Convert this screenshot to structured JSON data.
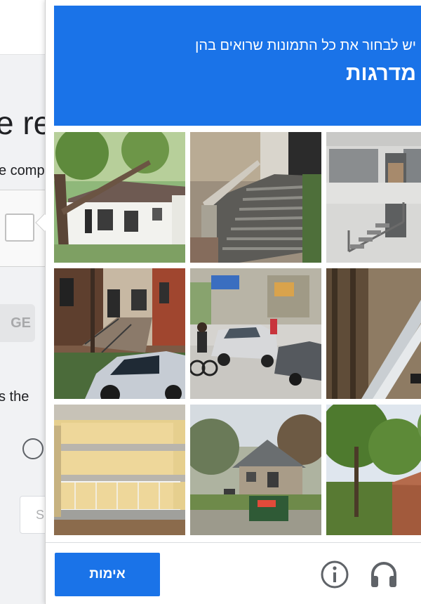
{
  "background_page": {
    "heading_fragment": "e re",
    "subtext_fragment": "e comp",
    "button_fragment": "GE",
    "question_fragment": "s the",
    "input_fragment": "S"
  },
  "challenge": {
    "instruction": "יש לבחור את כל התמונות שרואים בהן",
    "target": "מדרגות",
    "tiles": [
      {
        "icon": "house-with-tree"
      },
      {
        "icon": "concrete-stairs"
      },
      {
        "icon": "storefront-stairs"
      },
      {
        "icon": "brownstone-stoop-suv"
      },
      {
        "icon": "street-cyclist-cars"
      },
      {
        "icon": "stair-railing-closeup"
      },
      {
        "icon": "balcony-building"
      },
      {
        "icon": "house-dumpster"
      },
      {
        "icon": "tree-brick-house"
      }
    ],
    "verify_label": "אימות",
    "info_icon": "info-icon",
    "audio_icon": "headphones-icon"
  },
  "colors": {
    "accent": "#1a73e8",
    "page_bg": "#f1f2f4"
  }
}
